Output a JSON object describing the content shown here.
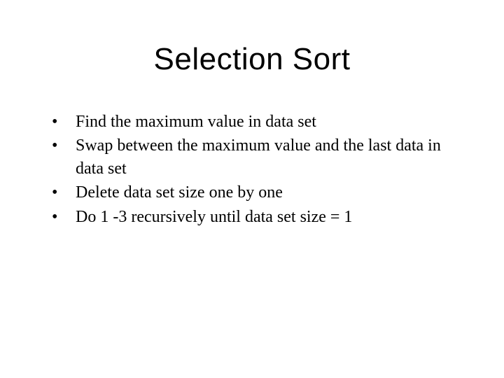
{
  "title": "Selection Sort",
  "bullet_marker": "•",
  "bullets": [
    "Find the maximum value in data set",
    "Swap between the maximum value and the last data in data set",
    "Delete data set size one by one",
    "Do 1 -3 recursively until data set size = 1"
  ]
}
